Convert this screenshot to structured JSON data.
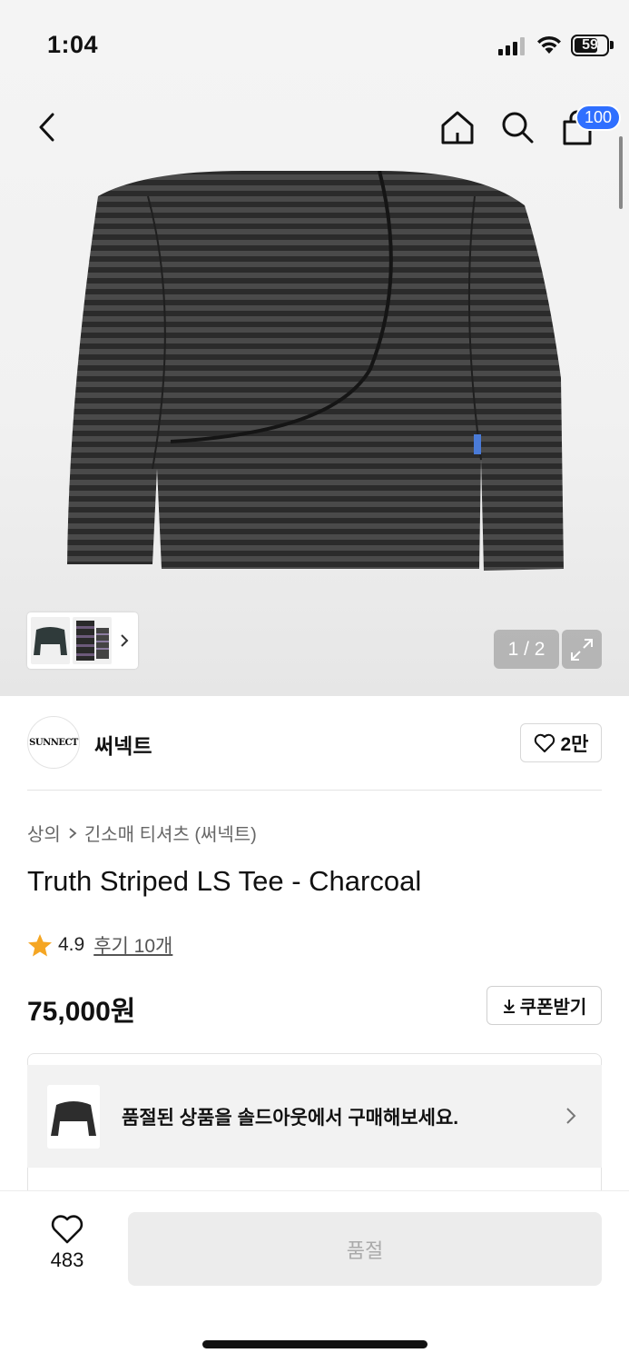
{
  "status_bar": {
    "time": "1:04",
    "battery": "59"
  },
  "nav": {
    "cart_count": "100"
  },
  "gallery": {
    "pager": "1 / 2"
  },
  "brand": {
    "logo_text": "SUNNECT",
    "name": "써넥트",
    "likes": "2만"
  },
  "breadcrumb": {
    "category": "상의",
    "subcategory": "긴소매 티셔츠 (써넥트)"
  },
  "product": {
    "title": "Truth Striped LS Tee - Charcoal",
    "rating": "4.9",
    "reviews": "후기 10개",
    "price": "75,000원",
    "coupon_label": "쿠폰받기"
  },
  "soldout_banner": {
    "text": "품절된 상품을 솔드아웃에서 구매해보세요."
  },
  "bottom": {
    "wish_count": "483",
    "buy_label": "품절"
  },
  "icons": {
    "back": "chevron-left-icon",
    "home": "home-icon",
    "search": "search-icon",
    "cart": "shopping-bag-icon",
    "expand": "expand-icon",
    "heart": "heart-icon",
    "star": "star-icon",
    "download": "download-icon"
  },
  "colors": {
    "badge": "#2f6fff",
    "star": "#f5a623",
    "soldout_bg": "#ececec"
  }
}
